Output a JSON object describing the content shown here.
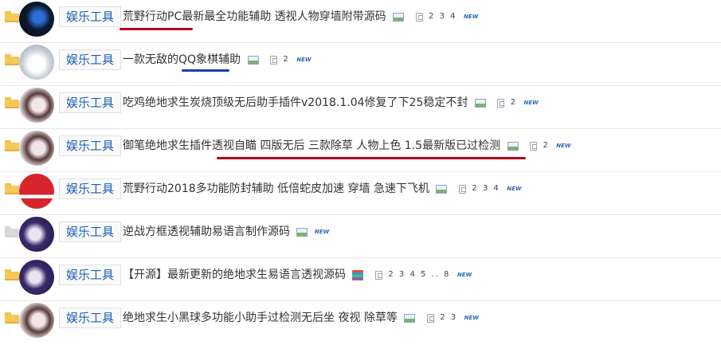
{
  "rows": [
    {
      "category": "娱乐工具",
      "title": "荒野行动PC最新最全功能辅助 透视人物穿墙附带源码",
      "pages": "2 3 4",
      "new": "NEW",
      "folder": "yellow",
      "avatar": "#0b1a2e"
    },
    {
      "category": "娱乐工具",
      "title": "一款无敌的QQ象棋辅助",
      "pages": "2",
      "new": "NEW",
      "folder": "yellow",
      "avatar": "#dfe3ea"
    },
    {
      "category": "娱乐工具",
      "title": "吃鸡绝地求生炭烧顶级无后助手插件v2018.1.04修复了下25稳定不封",
      "pages": "2",
      "new": "NEW",
      "folder": "yellow",
      "avatar": "#e9e2e6"
    },
    {
      "category": "娱乐工具",
      "title": "御笔绝地求生插件透视自瞄 四版无后 三款除草 人物上色 1.5最新版已过检测",
      "pages": "2",
      "new": "NEW",
      "folder": "yellow",
      "avatar": "#e9e2e6"
    },
    {
      "category": "娱乐工具",
      "title": "荒野行动2018多功能防封辅助 低倍蛇皮加速 穿墙 急速下飞机",
      "pages": "2 3 4",
      "new": "NEW",
      "folder": "yellow",
      "avatar": "#d6262c"
    },
    {
      "category": "娱乐工具",
      "title": "逆战方框透视辅助易语言制作源码",
      "pages": "",
      "new": "NEW",
      "folder": "grey",
      "avatar": "#3a2a6a"
    },
    {
      "category": "娱乐工具",
      "title": "【开源】最新更新的绝地求生易语言透视源码",
      "pages": "2 3 4 5 .. 8",
      "new": "NEW",
      "folder": "yellow",
      "avatar": "#3a2a6a"
    },
    {
      "category": "娱乐工具",
      "title": "绝地求生小黑球多功能小助手过检测无后坐 夜视 除草等",
      "pages": "2 3",
      "new": "NEW",
      "folder": "yellow",
      "avatar": "#e9e2e6"
    }
  ]
}
